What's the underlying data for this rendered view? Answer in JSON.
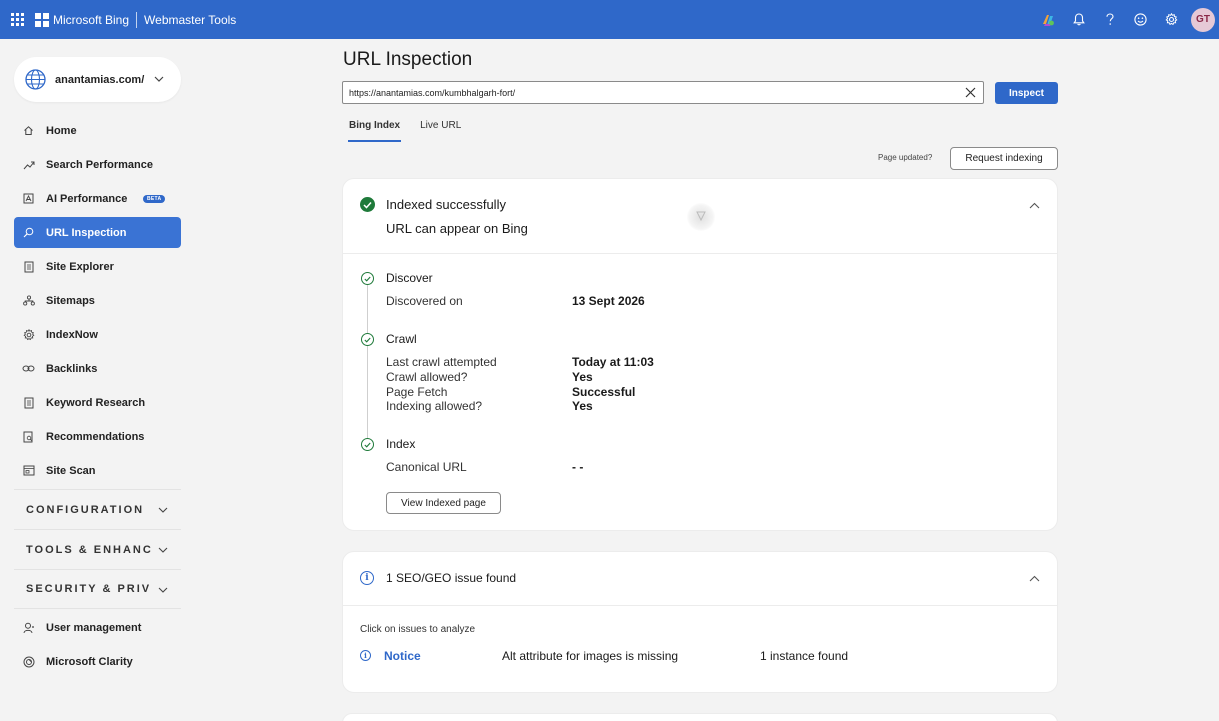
{
  "topbar": {
    "brand": "Microsoft Bing",
    "product": "Webmaster Tools",
    "avatar": "GT",
    "icons": [
      "copilot-icon",
      "bell-icon",
      "help-icon",
      "smiley-icon",
      "gear-icon"
    ]
  },
  "sidebar": {
    "site": "anantamias.com/",
    "items": [
      {
        "label": "Home",
        "icon": "home-icon"
      },
      {
        "label": "Search Performance",
        "icon": "trend-icon"
      },
      {
        "label": "AI Performance",
        "icon": "ai-icon",
        "badge": "BETA"
      },
      {
        "label": "URL Inspection",
        "icon": "search-icon",
        "active": true
      },
      {
        "label": "Site Explorer",
        "icon": "document-icon"
      },
      {
        "label": "Sitemaps",
        "icon": "sitemap-icon"
      },
      {
        "label": "IndexNow",
        "icon": "gear-icon"
      },
      {
        "label": "Backlinks",
        "icon": "link-icon"
      },
      {
        "label": "Keyword Research",
        "icon": "document-icon"
      },
      {
        "label": "Recommendations",
        "icon": "document-search-icon"
      },
      {
        "label": "Site Scan",
        "icon": "scan-icon"
      }
    ],
    "sections": [
      "CONFIGURATION",
      "TOOLS & ENHANC",
      "SECURITY & PRIV"
    ],
    "bottom_items": [
      {
        "label": "User management",
        "icon": "user-icon"
      },
      {
        "label": "Microsoft Clarity",
        "icon": "clarity-icon"
      }
    ]
  },
  "main": {
    "title": "URL Inspection",
    "url_value": "https://anantamias.com/kumbhalgarh-fort/",
    "inspect_label": "Inspect",
    "tabs": [
      "Bing Index",
      "Live URL"
    ],
    "page_updated": "Page updated?",
    "request_indexing": "Request indexing"
  },
  "status": {
    "title": "Indexed successfully",
    "subtitle": "URL can appear on Bing",
    "discover": {
      "title": "Discover",
      "rows": [
        {
          "key": "Discovered on",
          "value": "13 Sept 2026"
        }
      ]
    },
    "crawl": {
      "title": "Crawl",
      "rows": [
        {
          "key": "Last crawl attempted",
          "value": "Today at 11:03"
        },
        {
          "key": "Crawl allowed?",
          "value": "Yes"
        },
        {
          "key": "Page Fetch",
          "value": "Successful"
        },
        {
          "key": "Indexing allowed?",
          "value": "Yes"
        }
      ]
    },
    "index": {
      "title": "Index",
      "rows": [
        {
          "key": "Canonical URL",
          "value": "- -"
        }
      ]
    },
    "view_button": "View Indexed page"
  },
  "issues": {
    "title": "1 SEO/GEO issue found",
    "note": "Click on issues to analyze",
    "row": {
      "level": "Notice",
      "description": "Alt attribute for images is missing",
      "count": "1 instance found"
    }
  }
}
